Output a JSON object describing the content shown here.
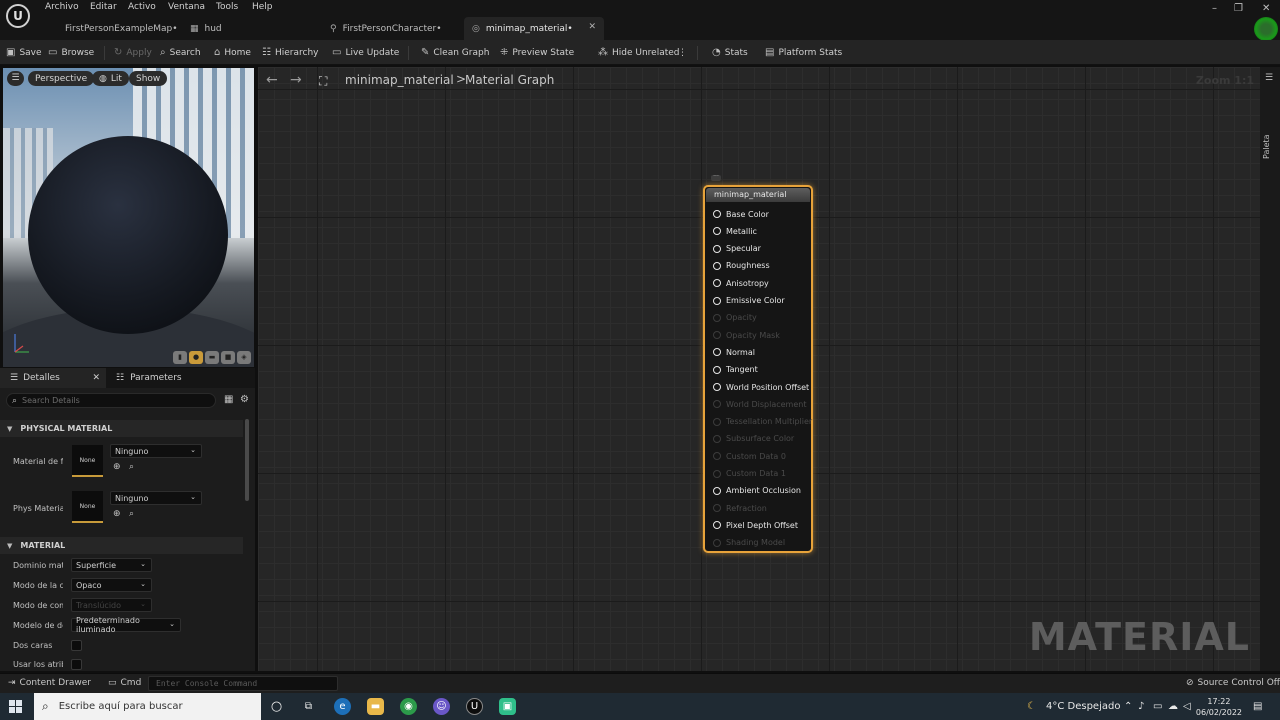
{
  "menu": {
    "items": [
      "Archivo",
      "Editar",
      "Activo",
      "Ventana",
      "Tools",
      "Help"
    ]
  },
  "tabs": [
    {
      "label": "FirstPersonExampleMap•",
      "icon": "level-icon"
    },
    {
      "label": "hud",
      "icon": "widget-icon"
    },
    {
      "label": "FirstPersonCharacter•",
      "icon": "blueprint-icon"
    },
    {
      "label": "minimap_material•",
      "icon": "material-icon",
      "active": true
    }
  ],
  "toolbar": {
    "save": "Save",
    "browse": "Browse",
    "apply": "Apply",
    "search": "Search",
    "home": "Home",
    "hierarchy": "Hierarchy",
    "live_update": "Live Update",
    "clean_graph": "Clean Graph",
    "preview_state": "Preview State",
    "hide_unrelated": "Hide Unrelated",
    "stats": "Stats",
    "platform_stats": "Platform Stats"
  },
  "viewport": {
    "perspective": "Perspective",
    "lit": "Lit",
    "show": "Show"
  },
  "details": {
    "tab_details": "Detalles",
    "tab_parameters": "Parameters",
    "search_placeholder": "Search Details",
    "section_physical": "PHYSICAL MATERIAL",
    "section_material": "MATERIAL",
    "phys_rows": [
      {
        "label": "Material de fís",
        "thumb": "None",
        "value": "Ninguno"
      },
      {
        "label": "Phys Material",
        "thumb": "None",
        "value": "Ninguno"
      }
    ],
    "material_rows": [
      {
        "label": "Dominio mater",
        "value": "Superficie"
      },
      {
        "label": "Modo de la cor",
        "value": "Opaco"
      },
      {
        "label": "Modo de comb",
        "value": "Translúcido"
      },
      {
        "label": "Modelo de deg",
        "value": "Predeterminado iluminado"
      },
      {
        "label": "Dos caras"
      },
      {
        "label": "Usar los atribu"
      }
    ]
  },
  "graph": {
    "breadcrumb_asset": "minimap_material",
    "breadcrumb_sep": ">",
    "breadcrumb_graph": "Material Graph",
    "zoom": "Zoom 1:1",
    "watermark": "MATERIAL",
    "node": {
      "title": "minimap_material",
      "pins": [
        {
          "label": "Base Color",
          "enabled": true
        },
        {
          "label": "Metallic",
          "enabled": true
        },
        {
          "label": "Specular",
          "enabled": true
        },
        {
          "label": "Roughness",
          "enabled": true
        },
        {
          "label": "Anisotropy",
          "enabled": true
        },
        {
          "label": "Emissive Color",
          "enabled": true
        },
        {
          "label": "Opacity",
          "enabled": false
        },
        {
          "label": "Opacity Mask",
          "enabled": false
        },
        {
          "label": "Normal",
          "enabled": true
        },
        {
          "label": "Tangent",
          "enabled": true
        },
        {
          "label": "World Position Offset",
          "enabled": true
        },
        {
          "label": "World Displacement",
          "enabled": false
        },
        {
          "label": "Tessellation Multiplier",
          "enabled": false
        },
        {
          "label": "Subsurface Color",
          "enabled": false
        },
        {
          "label": "Custom Data 0",
          "enabled": false
        },
        {
          "label": "Custom Data 1",
          "enabled": false
        },
        {
          "label": "Ambient Occlusion",
          "enabled": true
        },
        {
          "label": "Refraction",
          "enabled": false
        },
        {
          "label": "Pixel Depth Offset",
          "enabled": true
        },
        {
          "label": "Shading Model",
          "enabled": false
        }
      ]
    }
  },
  "palette": "Paleta",
  "status": {
    "content_drawer": "Content Drawer",
    "cmd": "Cmd",
    "console_placeholder": "Enter Console Command",
    "source_control": "Source Control Off"
  },
  "taskbar": {
    "search_placeholder": "Escribe aquí para buscar",
    "weather": "4°C  Despejado",
    "time": "17:22",
    "date": "06/02/2022"
  },
  "colors": {
    "node_border": "#e8a33a",
    "accent": "#c79a3a"
  }
}
